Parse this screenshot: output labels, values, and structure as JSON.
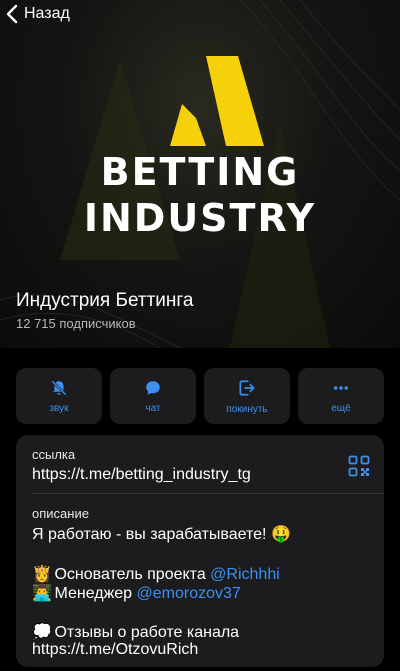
{
  "nav": {
    "back_label": "Назад"
  },
  "hero": {
    "logo_line1": "BETTING",
    "logo_line2": "INDUSTRY",
    "channel_name": "Индустрия Беттинга",
    "subscribers": "12 715 подписчиков"
  },
  "actions": [
    {
      "label": "звук",
      "icon": "bell-off-icon"
    },
    {
      "label": "чат",
      "icon": "chat-bubble-icon"
    },
    {
      "label": "покинуть",
      "icon": "leave-icon"
    },
    {
      "label": "ещё",
      "icon": "more-icon"
    }
  ],
  "info": {
    "link_label": "ссылка",
    "link_value": "https://t.me/betting_industry_tg",
    "desc_label": "описание",
    "desc_line1": "Я работаю - вы зарабатываете! 🤑",
    "founder_emoji": "👸",
    "founder_text": "Основатель проекта ",
    "founder_handle": "@Richhhi",
    "manager_emoji": "👨‍💻",
    "manager_text": "Менеджер ",
    "manager_handle": "@emorozov37",
    "reviews_emoji": "💭",
    "reviews_text": "Отзывы о работе канала",
    "reviews_link": "https://t.me/OtzovuRich"
  },
  "colors": {
    "accent": "#3d8ff0",
    "logo_yellow": "#f5d10a",
    "card_bg": "#1c1c1e"
  }
}
